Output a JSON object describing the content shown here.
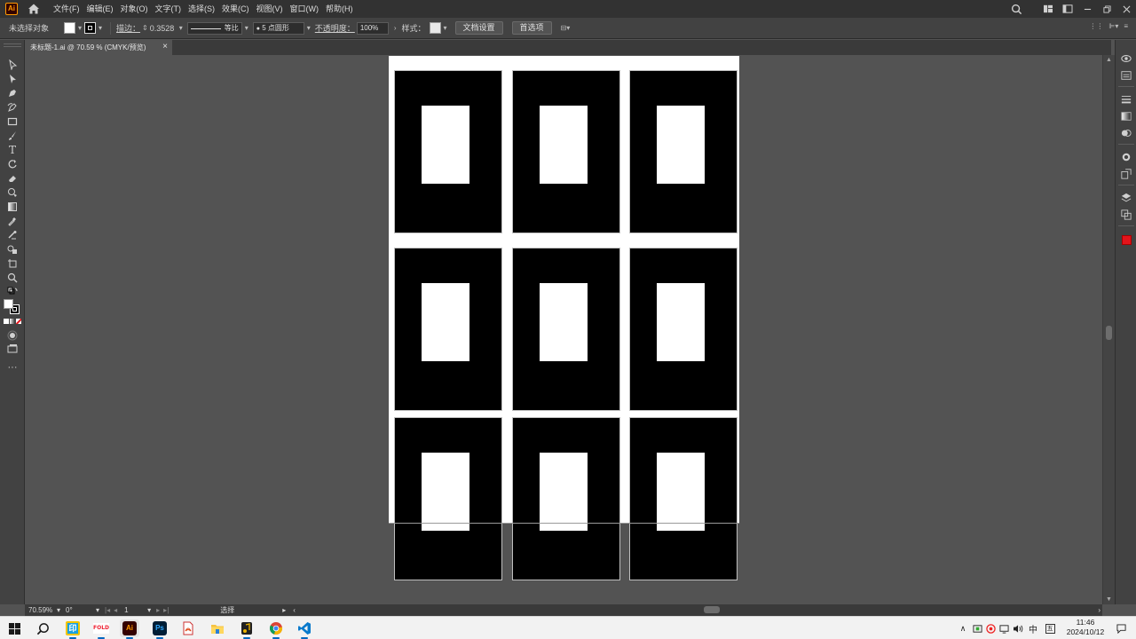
{
  "app": {
    "logo_text": "Ai"
  },
  "menu": [
    "文件(F)",
    "编辑(E)",
    "对象(O)",
    "文字(T)",
    "选择(S)",
    "效果(C)",
    "视图(V)",
    "窗口(W)",
    "帮助(H)"
  ],
  "control_bar": {
    "selection_label": "未选择对象",
    "stroke_label": "描边：",
    "stroke_value": "0.3528",
    "stroke_profile": "等比",
    "brush": "5 点圆形",
    "opacity_label": "不透明度：",
    "opacity_value": "100%",
    "style_label": "样式：",
    "doc_setup_button": "文档设置",
    "preferences_button": "首选项"
  },
  "document_tab": {
    "label": "未标题-1.ai @ 70.59 % (CMYK/预览)",
    "close": "×"
  },
  "status_bar": {
    "zoom": "70.59%",
    "rotation": "0°",
    "artboard_number": "1",
    "tool_status": "选择"
  },
  "taskbar": {
    "time": "11:46",
    "date": "2024/10/12",
    "ime_language": "中",
    "ime_mode": "五",
    "apps": [
      "start-icon",
      "search-icon",
      "notes-app-icon",
      "fold-app-icon",
      "illustrator-icon",
      "photoshop-icon",
      "pdf-reader-icon",
      "file-explorer-icon",
      "music-app-icon",
      "chrome-icon",
      "vscode-icon"
    ]
  },
  "colors": {
    "accent_illustrator": "#ff9a00",
    "photoshop": "#31a8ff",
    "swatch_red": "#e3141b"
  }
}
